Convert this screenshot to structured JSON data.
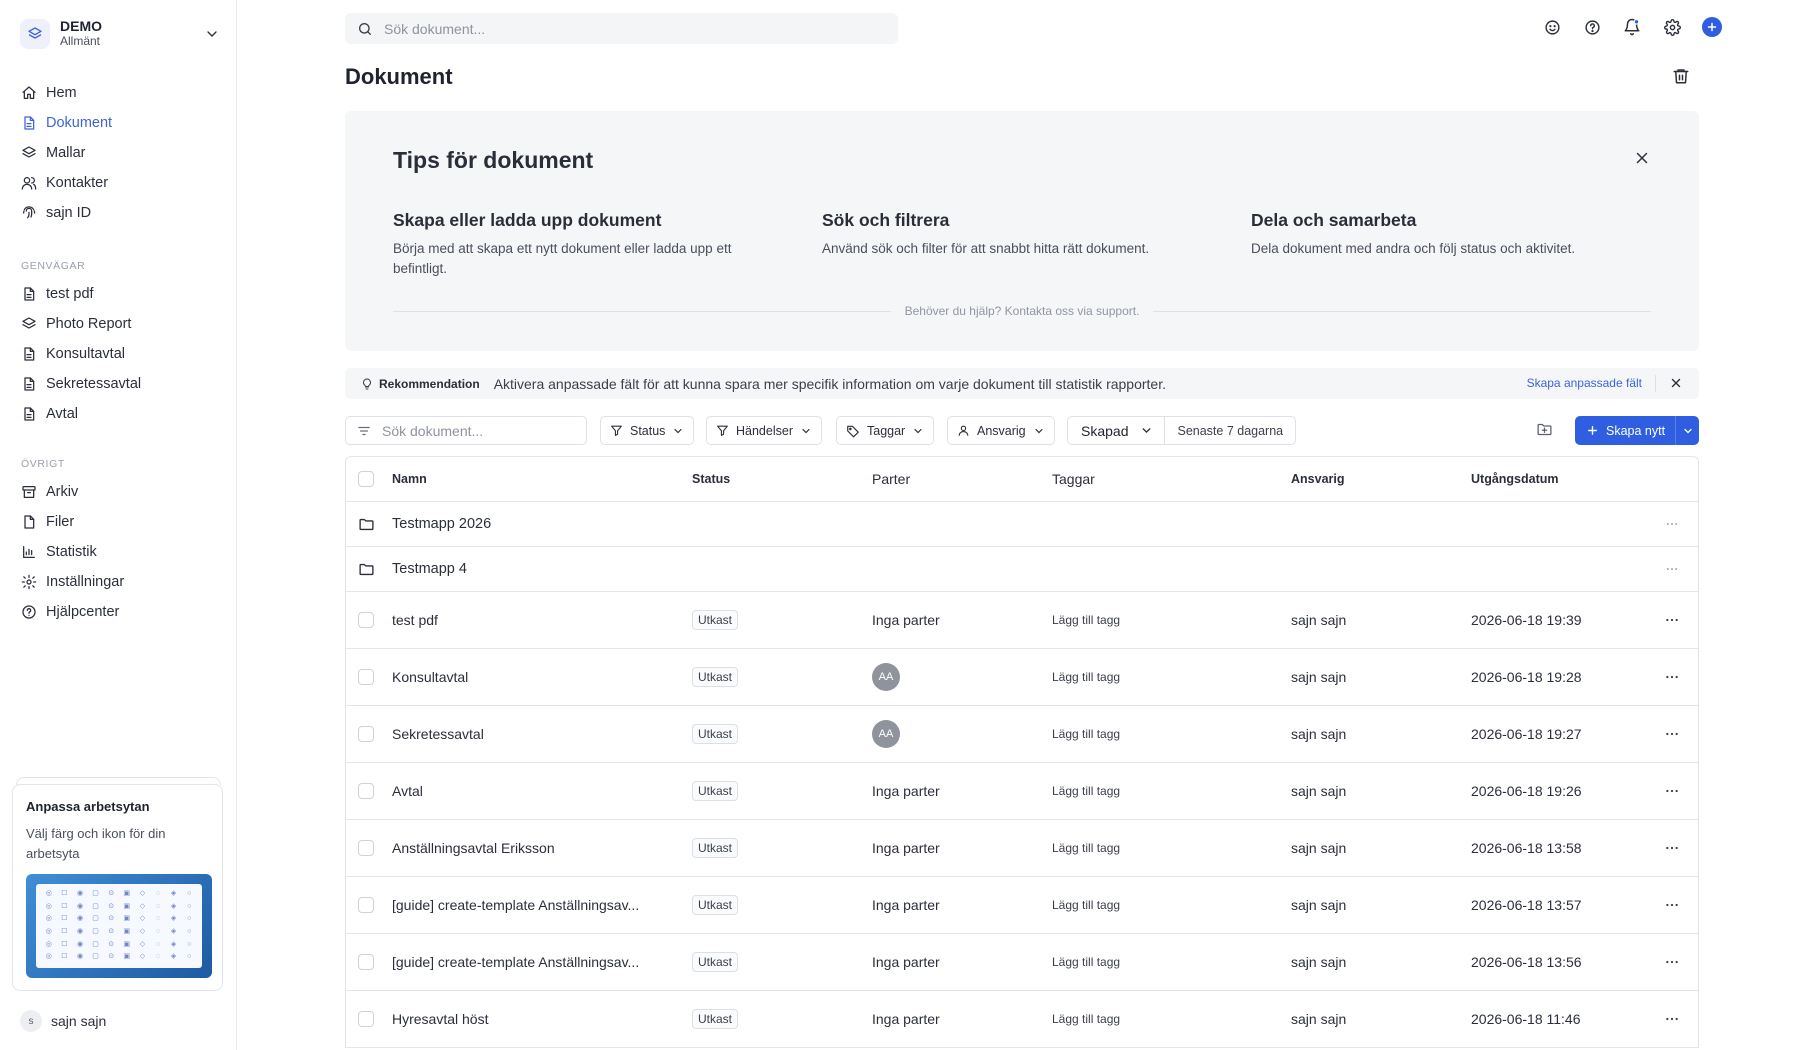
{
  "workspace": {
    "name": "DEMO",
    "sub": "Allmänt"
  },
  "nav": {
    "main": [
      {
        "label": "Hem",
        "icon": "home-icon"
      },
      {
        "label": "Dokument",
        "icon": "document-icon",
        "active": true
      },
      {
        "label": "Mallar",
        "icon": "layers-icon"
      },
      {
        "label": "Kontakter",
        "icon": "contacts-icon"
      },
      {
        "label": "sajn ID",
        "icon": "fingerprint-icon"
      }
    ],
    "shortcuts_head": "GENVÄGAR",
    "shortcuts": [
      {
        "label": "test pdf",
        "icon": "document-icon"
      },
      {
        "label": "Photo Report",
        "icon": "layers-icon"
      },
      {
        "label": "Konsultavtal",
        "icon": "document-icon"
      },
      {
        "label": "Sekretessavtal",
        "icon": "document-icon"
      },
      {
        "label": "Avtal",
        "icon": "document-icon"
      }
    ],
    "other_head": "ÖVRIGT",
    "other": [
      {
        "label": "Arkiv",
        "icon": "archive-icon"
      },
      {
        "label": "Filer",
        "icon": "file-icon"
      },
      {
        "label": "Statistik",
        "icon": "chart-icon"
      },
      {
        "label": "Inställningar",
        "icon": "gear-icon"
      },
      {
        "label": "Hjälpcenter",
        "icon": "help-icon"
      }
    ]
  },
  "promo": {
    "title": "Anpassa arbetsytan",
    "text": "Välj färg och ikon för din arbetsyta"
  },
  "user": {
    "initial": "s",
    "name": "sajn sajn"
  },
  "top": {
    "search_placeholder": "Sök dokument..."
  },
  "page": {
    "title": "Dokument"
  },
  "tips": {
    "title": "Tips för dokument",
    "items": [
      {
        "title": "Skapa eller ladda upp dokument",
        "text": "Börja med att skapa ett nytt dokument eller ladda upp ett befintligt."
      },
      {
        "title": "Sök och filtrera",
        "text": "Använd sök och filter för att snabbt hitta rätt dokument."
      },
      {
        "title": "Dela och samarbeta",
        "text": "Dela dokument med andra och följ status och aktivitet."
      }
    ],
    "help": "Behöver du hjälp? Kontakta oss via support."
  },
  "rec": {
    "label": "Rekommendation",
    "text": "Aktivera anpassade fält för att kunna spara mer specifik information om varje dokument till statistik rapporter.",
    "link": "Skapa anpassade fält"
  },
  "filters": {
    "search_placeholder": "Sök dokument...",
    "status": "Status",
    "events": "Händelser",
    "tags": "Taggar",
    "owner": "Ansvarig",
    "created": "Skapad",
    "range": "Senaste 7 dagarna",
    "create": "Skapa nytt"
  },
  "table": {
    "headers": {
      "name": "Namn",
      "status": "Status",
      "parter": "Parter",
      "tags": "Taggar",
      "owner": "Ansvarig",
      "expiry": "Utgångsdatum"
    },
    "folders": [
      {
        "name": "Testmapp 2026"
      },
      {
        "name": "Testmapp 4"
      }
    ],
    "rows": [
      {
        "name": "test pdf",
        "status": "Utkast",
        "parter": "Inga parter",
        "tag": "Lägg till tagg",
        "owner": "sajn sajn",
        "date": "2026-06-18 19:39"
      },
      {
        "name": "Konsultavtal",
        "status": "Utkast",
        "parter_avatar": "AA",
        "tag": "Lägg till tagg",
        "owner": "sajn sajn",
        "date": "2026-06-18 19:28"
      },
      {
        "name": "Sekretessavtal",
        "status": "Utkast",
        "parter_avatar": "AA",
        "tag": "Lägg till tagg",
        "owner": "sajn sajn",
        "date": "2026-06-18 19:27"
      },
      {
        "name": "Avtal",
        "status": "Utkast",
        "parter": "Inga parter",
        "tag": "Lägg till tagg",
        "owner": "sajn sajn",
        "date": "2026-06-18 19:26"
      },
      {
        "name": "Anställningsavtal Eriksson",
        "status": "Utkast",
        "parter": "Inga parter",
        "tag": "Lägg till tagg",
        "owner": "sajn sajn",
        "date": "2026-06-18 13:58"
      },
      {
        "name": "[guide] create-template Anställningsav...",
        "status": "Utkast",
        "parter": "Inga parter",
        "tag": "Lägg till tagg",
        "owner": "sajn sajn",
        "date": "2026-06-18 13:57"
      },
      {
        "name": "[guide] create-template Anställningsav...",
        "status": "Utkast",
        "parter": "Inga parter",
        "tag": "Lägg till tagg",
        "owner": "sajn sajn",
        "date": "2026-06-18 13:56"
      },
      {
        "name": "Hyresavtal höst",
        "status": "Utkast",
        "parter": "Inga parter",
        "tag": "Lägg till tagg",
        "owner": "sajn sajn",
        "date": "2026-06-18 11:46"
      }
    ]
  },
  "colors": {
    "accent": "#2f5fe0",
    "link": "#3d63dd",
    "panel": "#f5f6f8"
  }
}
